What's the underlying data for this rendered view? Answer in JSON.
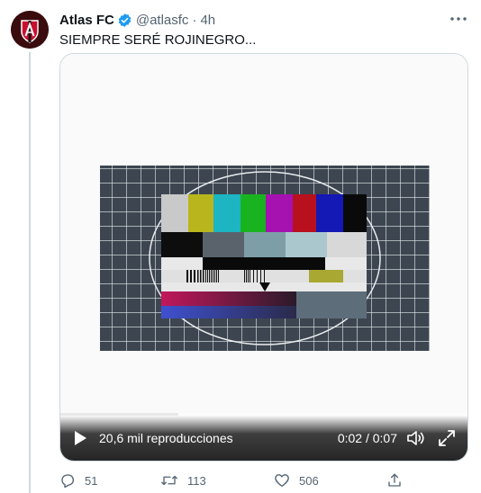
{
  "tweet": {
    "author_name": "Atlas FC",
    "handle": "@atlasfc",
    "separator": "·",
    "time": "4h",
    "text": "SIEMPRE SERÉ ROJINEGRO..."
  },
  "video": {
    "views": "20,6 mil reproducciones",
    "timecode": "0:02 / 0:07",
    "progress": 0.29
  },
  "actions": {
    "reply_count": "51",
    "retweet_count": "113",
    "like_count": "506"
  },
  "icons": {
    "verified": "verified-badge-icon",
    "more": "more-options-icon",
    "play": "play-icon",
    "volume": "volume-icon",
    "fullscreen": "fullscreen-icon",
    "reply": "reply-icon",
    "retweet": "retweet-icon",
    "like": "heart-icon",
    "share": "share-icon"
  },
  "colors": {
    "accent": "#1d9bf0",
    "text": "#0f1419",
    "muted": "#536471",
    "border": "#cfd9de",
    "brand_red": "#c8102e"
  }
}
